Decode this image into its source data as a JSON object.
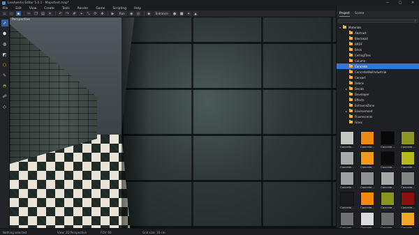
{
  "window": {
    "title": "Leadwerks Editor 5.0.1 - Maps/test.map*",
    "minimize": "—",
    "maximize": "□",
    "close": "✕"
  },
  "menu": [
    "File",
    "Edit",
    "View",
    "Create",
    "Tools",
    "Render",
    "Game",
    "Scripting",
    "Help"
  ],
  "toolbar": {
    "run_label": "Run",
    "material_label": "Entrance"
  },
  "viewport": {
    "label": "Perspective"
  },
  "status": {
    "left": "Nothing selected",
    "view": "View: 3D Perspective",
    "fov": "FOV: 60",
    "grid": "Grid size: 16 cm"
  },
  "panel": {
    "tabs": [
      "Project",
      "Scene"
    ],
    "tree": [
      {
        "label": "Materials",
        "indent": 0,
        "arrow": "▾",
        "selected": false
      },
      {
        "label": "Abstract",
        "indent": 1,
        "arrow": "",
        "selected": false
      },
      {
        "label": "Blockwall",
        "indent": 1,
        "arrow": "",
        "selected": false
      },
      {
        "label": "BRDF",
        "indent": 1,
        "arrow": "",
        "selected": false
      },
      {
        "label": "Brick",
        "indent": 1,
        "arrow": "",
        "selected": false
      },
      {
        "label": "CeilingTiles",
        "indent": 1,
        "arrow": "",
        "selected": false
      },
      {
        "label": "Column",
        "indent": 1,
        "arrow": "",
        "selected": false
      },
      {
        "label": "Concrete",
        "indent": 1,
        "arrow": "",
        "selected": true
      },
      {
        "label": "ConcreteWallIndustrial",
        "indent": 1,
        "arrow": "",
        "selected": false
      },
      {
        "label": "Consort",
        "indent": 1,
        "arrow": "",
        "selected": false
      },
      {
        "label": "Debris",
        "indent": 1,
        "arrow": "",
        "selected": false
      },
      {
        "label": "Decals",
        "indent": 1,
        "arrow": "▸",
        "selected": false
      },
      {
        "label": "Developer",
        "indent": 1,
        "arrow": "",
        "selected": false
      },
      {
        "label": "Effects",
        "indent": 1,
        "arrow": "",
        "selected": false
      },
      {
        "label": "EntranceZone",
        "indent": 1,
        "arrow": "",
        "selected": false
      },
      {
        "label": "Environment",
        "indent": 1,
        "arrow": "▸",
        "selected": false
      },
      {
        "label": "Fluorescents",
        "indent": 1,
        "arrow": "",
        "selected": false
      },
      {
        "label": "Glass",
        "indent": 1,
        "arrow": "",
        "selected": false
      }
    ],
    "thumbs": [
      {
        "label": "Concrete...",
        "color": "#c5c7c4"
      },
      {
        "label": "Concrete...",
        "color": "#f08a12"
      },
      {
        "label": "Concrete...",
        "color": "#080808"
      },
      {
        "label": "Concrete...",
        "color": "#8c9620"
      },
      {
        "label": "Concrete...",
        "color": "#a8aaa9"
      },
      {
        "label": "Concrete...",
        "color": "#f49a1a"
      },
      {
        "label": "Concrete...",
        "color": "#0a0a0a"
      },
      {
        "label": "Concrete...",
        "color": "#b4ba1e"
      },
      {
        "label": "Concrete...",
        "color": "#9fa1a0"
      },
      {
        "label": "Concrete...",
        "color": "#8f9190"
      },
      {
        "label": "Concrete...",
        "color": "#a7a9a8"
      },
      {
        "label": "Concrete...",
        "color": "#828483"
      },
      {
        "label": "Concrete...",
        "color": "#1a1a1a"
      },
      {
        "label": "Concrete...",
        "color": "#f28a10"
      },
      {
        "label": "Concrete...",
        "color": "#8a9520"
      },
      {
        "label": "Concrete...",
        "color": "#8e0f0f"
      },
      {
        "label": "Concrete...",
        "color": "#6f7170"
      },
      {
        "label": "Concrete...",
        "color": "#dcdcdc"
      },
      {
        "label": "Concrete...",
        "color": "#6b6d6c"
      },
      {
        "label": "Concrete...",
        "color": "#f0a828"
      }
    ]
  }
}
